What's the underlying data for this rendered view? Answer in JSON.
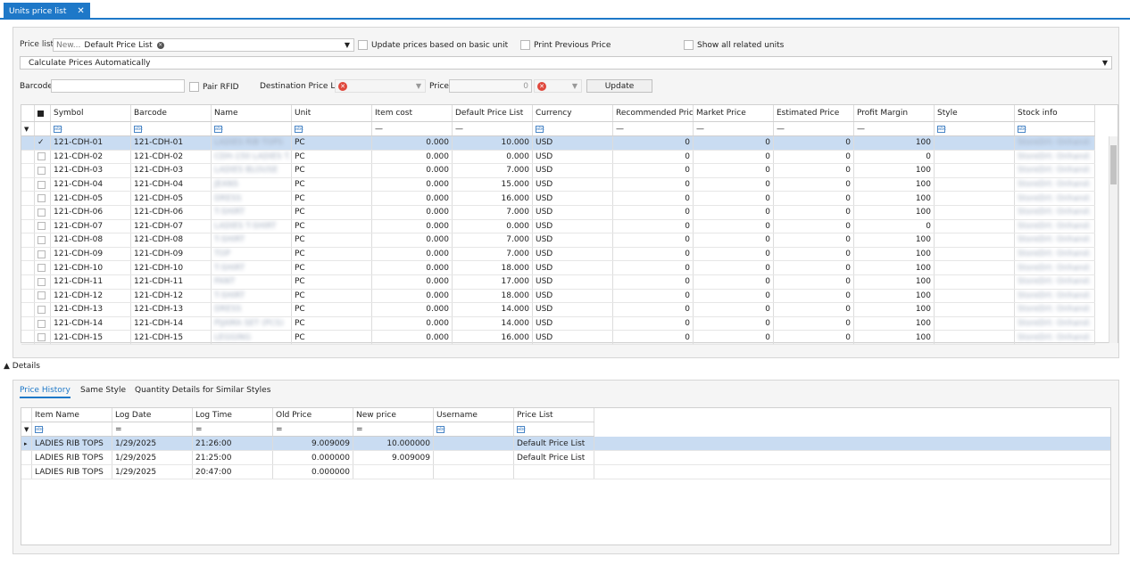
{
  "tab": {
    "title": "Units price list",
    "close": "✕"
  },
  "top": {
    "price_list_label": "Price list",
    "price_list_new": "New...",
    "price_list_value": "Default Price List",
    "update_basic": "Update prices based on basic unit",
    "print_prev": "Print Previous Price",
    "show_related": "Show all related units",
    "calc_mode": "Calculate Prices Automatically",
    "barcode_label": "Barcode",
    "barcode_value": "",
    "pair_rfid": "Pair RFID",
    "dest_label": "Destination Price List",
    "price_label": "Price",
    "price_value": "0",
    "update_btn": "Update"
  },
  "grid": {
    "columns": [
      "Symbol",
      "Barcode",
      "Name",
      "Unit",
      "Item cost",
      "Default Price List",
      "Currency",
      "Recommended Price",
      "Market Price",
      "Estimated Price",
      "Profit Margin",
      "Style",
      "Stock info"
    ],
    "rows": [
      {
        "sym": "121-CDH-01",
        "bc": "121-CDH-01",
        "name": "LADIES RIB TOPS",
        "unit": "PC",
        "cost": "0.000",
        "def": "10.000",
        "cur": "USD",
        "rec": "0",
        "mkt": "0",
        "est": "0",
        "pm": "100",
        "style": "",
        "stock": "StoreDrt: Onhand:",
        "checked": true
      },
      {
        "sym": "121-CDH-02",
        "bc": "121-CDH-02",
        "name": "CDH-150 LADIES T.",
        "unit": "PC",
        "cost": "0.000",
        "def": "0.000",
        "cur": "USD",
        "rec": "0",
        "mkt": "0",
        "est": "0",
        "pm": "0",
        "style": "",
        "stock": "StoreDrt: Onhand:",
        "checked": false
      },
      {
        "sym": "121-CDH-03",
        "bc": "121-CDH-03",
        "name": "LADIES BLOUSE",
        "unit": "PC",
        "cost": "0.000",
        "def": "7.000",
        "cur": "USD",
        "rec": "0",
        "mkt": "0",
        "est": "0",
        "pm": "100",
        "style": "",
        "stock": "StoreDrt: Onhand:",
        "checked": false
      },
      {
        "sym": "121-CDH-04",
        "bc": "121-CDH-04",
        "name": "JEANS",
        "unit": "PC",
        "cost": "0.000",
        "def": "15.000",
        "cur": "USD",
        "rec": "0",
        "mkt": "0",
        "est": "0",
        "pm": "100",
        "style": "",
        "stock": "StoreDrt: Onhand:",
        "checked": false
      },
      {
        "sym": "121-CDH-05",
        "bc": "121-CDH-05",
        "name": "DRESS",
        "unit": "PC",
        "cost": "0.000",
        "def": "16.000",
        "cur": "USD",
        "rec": "0",
        "mkt": "0",
        "est": "0",
        "pm": "100",
        "style": "",
        "stock": "StoreDrt: Onhand:",
        "checked": false
      },
      {
        "sym": "121-CDH-06",
        "bc": "121-CDH-06",
        "name": "T-SHIRT",
        "unit": "PC",
        "cost": "0.000",
        "def": "7.000",
        "cur": "USD",
        "rec": "0",
        "mkt": "0",
        "est": "0",
        "pm": "100",
        "style": "",
        "stock": "StoreDrt: Onhand:",
        "checked": false
      },
      {
        "sym": "121-CDH-07",
        "bc": "121-CDH-07",
        "name": "LADIES T-SHIRT",
        "unit": "PC",
        "cost": "0.000",
        "def": "0.000",
        "cur": "USD",
        "rec": "0",
        "mkt": "0",
        "est": "0",
        "pm": "0",
        "style": "",
        "stock": "StoreDrt: Onhand:",
        "checked": false
      },
      {
        "sym": "121-CDH-08",
        "bc": "121-CDH-08",
        "name": "T-SHIRT",
        "unit": "PC",
        "cost": "0.000",
        "def": "7.000",
        "cur": "USD",
        "rec": "0",
        "mkt": "0",
        "est": "0",
        "pm": "100",
        "style": "",
        "stock": "StoreDrt: Onhand:",
        "checked": false
      },
      {
        "sym": "121-CDH-09",
        "bc": "121-CDH-09",
        "name": "TOP",
        "unit": "PC",
        "cost": "0.000",
        "def": "7.000",
        "cur": "USD",
        "rec": "0",
        "mkt": "0",
        "est": "0",
        "pm": "100",
        "style": "",
        "stock": "StoreDrt: Onhand:",
        "checked": false
      },
      {
        "sym": "121-CDH-10",
        "bc": "121-CDH-10",
        "name": "T-SHIRT",
        "unit": "PC",
        "cost": "0.000",
        "def": "18.000",
        "cur": "USD",
        "rec": "0",
        "mkt": "0",
        "est": "0",
        "pm": "100",
        "style": "",
        "stock": "StoreDrt: Onhand:",
        "checked": false
      },
      {
        "sym": "121-CDH-11",
        "bc": "121-CDH-11",
        "name": "PANT",
        "unit": "PC",
        "cost": "0.000",
        "def": "17.000",
        "cur": "USD",
        "rec": "0",
        "mkt": "0",
        "est": "0",
        "pm": "100",
        "style": "",
        "stock": "StoreDrt: Onhand:",
        "checked": false
      },
      {
        "sym": "121-CDH-12",
        "bc": "121-CDH-12",
        "name": "T-SHIRT",
        "unit": "PC",
        "cost": "0.000",
        "def": "18.000",
        "cur": "USD",
        "rec": "0",
        "mkt": "0",
        "est": "0",
        "pm": "100",
        "style": "",
        "stock": "StoreDrt: Onhand:",
        "checked": false
      },
      {
        "sym": "121-CDH-13",
        "bc": "121-CDH-13",
        "name": "DRESS",
        "unit": "PC",
        "cost": "0.000",
        "def": "14.000",
        "cur": "USD",
        "rec": "0",
        "mkt": "0",
        "est": "0",
        "pm": "100",
        "style": "",
        "stock": "StoreDrt: Onhand:",
        "checked": false
      },
      {
        "sym": "121-CDH-14",
        "bc": "121-CDH-14",
        "name": "PIJAMA SET (PCS)",
        "unit": "PC",
        "cost": "0.000",
        "def": "14.000",
        "cur": "USD",
        "rec": "0",
        "mkt": "0",
        "est": "0",
        "pm": "100",
        "style": "",
        "stock": "StoreDrt: Onhand:",
        "checked": false
      },
      {
        "sym": "121-CDH-15",
        "bc": "121-CDH-15",
        "name": "LEGGING",
        "unit": "PC",
        "cost": "0.000",
        "def": "16.000",
        "cur": "USD",
        "rec": "0",
        "mkt": "0",
        "est": "0",
        "pm": "100",
        "style": "",
        "stock": "StoreDrt: Onhand:",
        "checked": false
      }
    ]
  },
  "details": {
    "title": "Details",
    "tabs": [
      "Price History",
      "Same Style",
      "Quantity Details for Similar Styles"
    ],
    "columns": [
      "Item Name",
      "Log Date",
      "Log Time",
      "Old Price",
      "New price",
      "Username",
      "Price List"
    ],
    "rows": [
      {
        "item": "LADIES RIB TOPS",
        "date": "1/29/2025",
        "time": "21:26:00",
        "old": "9.009009",
        "new": "10.000000",
        "user": "",
        "pl": "Default Price List"
      },
      {
        "item": "LADIES RIB TOPS",
        "date": "1/29/2025",
        "time": "21:25:00",
        "old": "0.000000",
        "new": "9.009009",
        "user": "",
        "pl": "Default Price List"
      },
      {
        "item": "LADIES RIB TOPS",
        "date": "1/29/2025",
        "time": "20:47:00",
        "old": "0.000000",
        "new": "",
        "user": "",
        "pl": ""
      }
    ]
  }
}
